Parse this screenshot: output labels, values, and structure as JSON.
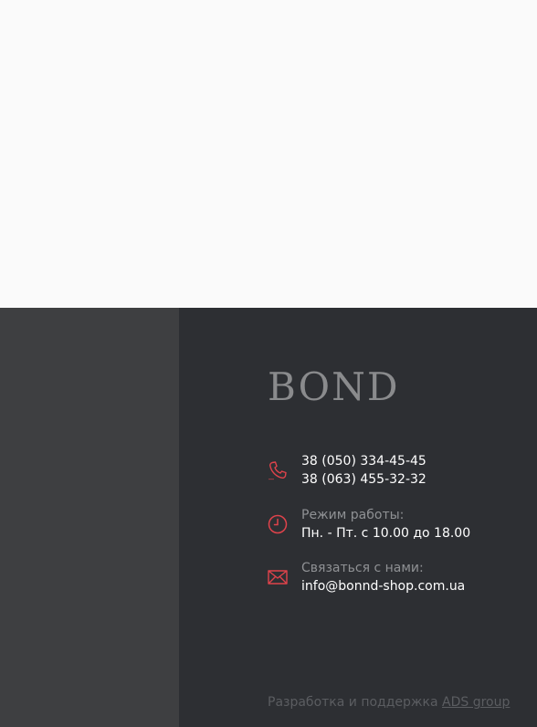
{
  "footer": {
    "logo": "BOND",
    "phone": {
      "icon": "phone-icon",
      "line1": "38 (050) 334-45-45",
      "line2": "38 (063) 455-32-32"
    },
    "hours": {
      "icon": "clock-icon",
      "label": "Режим работы:",
      "value": "Пн. - Пт. с 10.00 до 18.00"
    },
    "contact": {
      "icon": "envelope-icon",
      "label": "Связаться с нами:",
      "email": "info@bonnd-shop.com.ua"
    },
    "credits": {
      "text": "Разработка и поддержка",
      "link": "ADS group"
    }
  },
  "colors": {
    "accent": "#e0434b",
    "footer_bg": "#2d2f33",
    "footer_left_bg": "#3e3f41",
    "page_bg": "#fafafa"
  }
}
